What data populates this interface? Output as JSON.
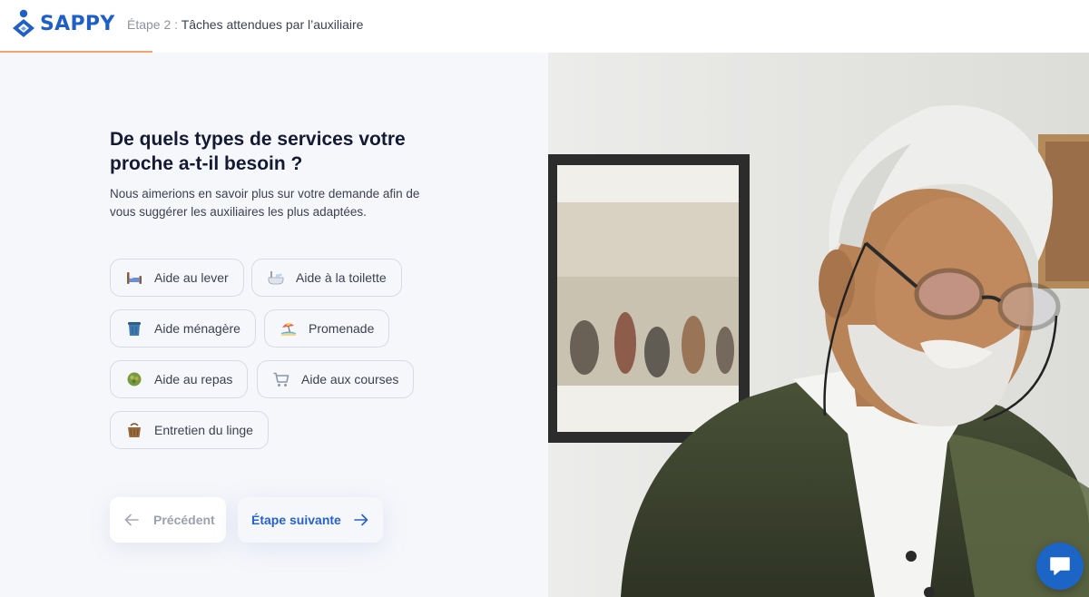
{
  "header": {
    "brand": "SAPPY",
    "step_number": "Étape 2 :",
    "step_title": "Tâches attendues par l’auxiliaire",
    "progress_fraction": 0.14
  },
  "main": {
    "title": "De quels types de services votre proche a-t-il besoin ?",
    "subtitle": "Nous aimerions en savoir plus sur votre demande afin de vous suggérer les auxiliaires les plus adaptées."
  },
  "services": [
    {
      "label": "Aide au lever",
      "icon": "bed-icon"
    },
    {
      "label": "Aide à la toilette",
      "icon": "bathtub-icon"
    },
    {
      "label": "Aide ménagère",
      "icon": "trash-bin-icon"
    },
    {
      "label": "Promenade",
      "icon": "beach-umbrella-icon"
    },
    {
      "label": "Aide au repas",
      "icon": "salad-bowl-icon"
    },
    {
      "label": "Aide aux courses",
      "icon": "shopping-cart-icon"
    },
    {
      "label": "Entretien du linge",
      "icon": "laundry-basket-icon"
    }
  ],
  "navigation": {
    "previous_label": "Précédent",
    "next_label": "Étape suivante"
  },
  "colors": {
    "brand_blue": "#1f5fc7",
    "progress_orange": "#f3a36e",
    "title_dark": "#151a34",
    "chat_blue": "#1d64c7"
  }
}
